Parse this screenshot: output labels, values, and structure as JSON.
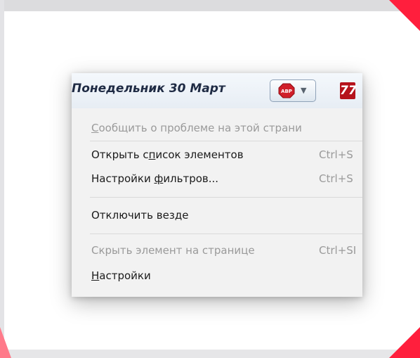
{
  "toolbar": {
    "date_text": "Понедельник 30 Март",
    "abp_button": {
      "icon": "abp-icon",
      "arrow": "▼"
    },
    "other_icon": {
      "glyph": "77",
      "color": "#b5121b"
    }
  },
  "menu": {
    "items": [
      {
        "parts": [
          {
            "t": "",
            "u": false
          },
          {
            "t": "С",
            "u": true
          },
          {
            "t": "ообщить о проблеме на этой страни",
            "u": false
          }
        ],
        "shortcut": "",
        "disabled": true
      },
      {
        "parts": [
          {
            "t": "Открыть с",
            "u": false
          },
          {
            "t": "п",
            "u": true
          },
          {
            "t": "исок элементов",
            "u": false
          }
        ],
        "shortcut": "Ctrl+S",
        "disabled": false
      },
      {
        "parts": [
          {
            "t": "Настройки ",
            "u": false
          },
          {
            "t": "ф",
            "u": true
          },
          {
            "t": "ильтров...",
            "u": false
          }
        ],
        "shortcut": "Ctrl+S",
        "disabled": false
      },
      {
        "parts": [
          {
            "t": "Отключить везде",
            "u": false
          }
        ],
        "shortcut": "",
        "disabled": false
      },
      {
        "parts": [
          {
            "t": "Скрыть элемент на странице",
            "u": false
          }
        ],
        "shortcut": "Ctrl+SI",
        "disabled": true
      },
      {
        "parts": [
          {
            "t": "Н",
            "u": true
          },
          {
            "t": "астройки",
            "u": false
          }
        ],
        "shortcut": "",
        "disabled": false
      }
    ]
  },
  "colors": {
    "watermark": "#ff1f3d",
    "menu_bg": "#f2f2f2",
    "toolbar_bg": "#e7edf4"
  }
}
